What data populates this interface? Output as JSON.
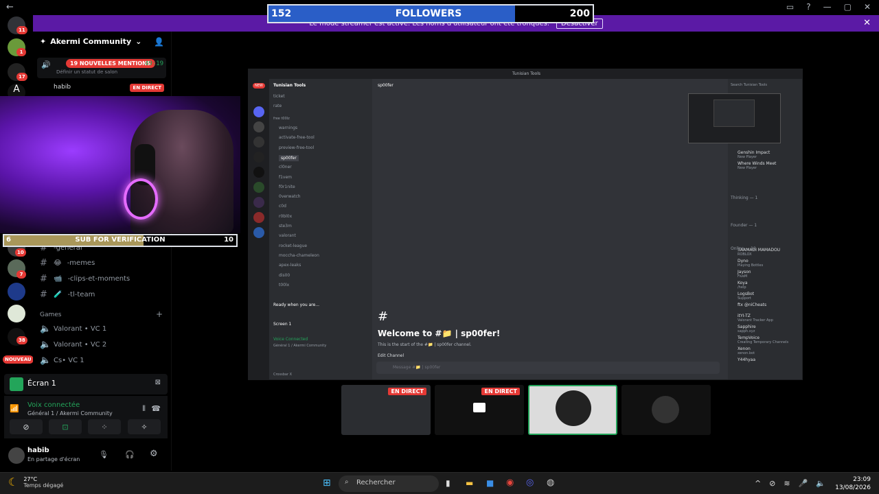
{
  "window": {
    "back": "←"
  },
  "followers": {
    "current": "152",
    "label": "FOLLOWERS",
    "goal": "200",
    "progress": 0.76
  },
  "banner": {
    "text": "Le mode streamer est activé. Les noms d'utilisateur ont été tronqués.",
    "button": "Désactiver"
  },
  "server": {
    "name": "Akermi Community"
  },
  "voice": {
    "mentions": "19 NOUVELLES MENTIONS",
    "timer": "49:19",
    "status_placeholder": "Définir un statut de salon",
    "user": "habib",
    "live": "EN DIRECT"
  },
  "rail_badges": [
    "11",
    "1",
    "17",
    "10",
    "7",
    "38",
    "1"
  ],
  "rail_new": "NOUVEAU",
  "channels": [
    {
      "label": "-general",
      "icon": ""
    },
    {
      "label": "-memes",
      "icon": "😂"
    },
    {
      "label": "-clips-et-moments",
      "icon": "📹"
    },
    {
      "label": "-tl-team",
      "icon": "🧪"
    }
  ],
  "games_category": "Games",
  "voice_channels": [
    "Valorant • VC 1",
    "Valorant • VC 2",
    "Cs• VC 1"
  ],
  "sub": {
    "current": "6",
    "label": "SUB FOR VERIFICATION",
    "goal": "10",
    "progress": 0.6
  },
  "screen_panel": {
    "label": "Écran 1"
  },
  "voice_panel": {
    "status": "Voix connectée",
    "location": "Général 1 / Akermi Community"
  },
  "user_panel": {
    "name": "habib",
    "status": "En partage d'écran"
  },
  "share": {
    "title": "Tunisian Tools",
    "server_name": "Tunisian Tools",
    "channel_header": "sp00fer",
    "top_channels": [
      "ticket",
      "rate"
    ],
    "category": "free t00lz",
    "channels": [
      "warnings",
      "activate-free-tool",
      "preview-free-tool",
      "sp00fer",
      "cl0ner",
      "f1vem",
      "f0r1nite",
      "0verwatch",
      "c0d",
      "r0bl0x",
      "ste3m",
      "valorant",
      "rocket-league",
      "moccha-chameleon",
      "apex-leaks",
      "dis00",
      "t00lx"
    ],
    "voice_status": "Voice Connected",
    "voice_location": "Général 1 / Akermi Community",
    "screen_label": "Screen 1",
    "ready_text": "Ready when you are...",
    "welcome": "Welcome to #📁 | sp00fer!",
    "welcome_sub": "This is the start of the #📁 | sp00fer channel.",
    "edit": "Edit Channel",
    "message_placeholder": "Message #📁 | sp00fer",
    "search": "Search Tunisian Tools",
    "member_groups": [
      "Thinking — 1",
      "Founder — 1",
      "Online — 12"
    ],
    "members": [
      {
        "name": "Genshin Impact",
        "sub": "New Player"
      },
      {
        "name": "Where Winds Meet",
        "sub": "New Player"
      },
      {
        "name": "3AAMADI MAMADOU",
        "sub": "ROBLOX"
      },
      {
        "name": "Dyno",
        "sub": "Playing Bottles"
      },
      {
        "name": "Jayson",
        "sub": "FiveM"
      },
      {
        "name": "Koya",
        "sub": "/help"
      },
      {
        "name": "LogsBot",
        "sub": "Support"
      },
      {
        "name": "ftx @niCheats",
        "sub": ""
      },
      {
        "name": "itYI-TZ",
        "sub": "Valorant Tracker App"
      },
      {
        "name": "Sapphire",
        "sub": "sapph.xyz"
      },
      {
        "name": "TempVoice",
        "sub": "Creating Temporary Channels"
      },
      {
        "name": "Xenon",
        "sub": "xenon.bot"
      },
      {
        "name": "Y44hyaa",
        "sub": ""
      }
    ],
    "user": "Crossbar X"
  },
  "tiles": [
    {
      "live": "EN DIRECT"
    },
    {
      "live": "EN DIRECT"
    }
  ],
  "taskbar": {
    "temp": "27°C",
    "weather": "Temps dégagé",
    "search": "Rechercher",
    "time": "23:09",
    "date": "13/08/2026"
  },
  "colors": {
    "live": "#e53935",
    "accent": "#5865f2",
    "voice_green": "#23a55a",
    "followers_fill": "#2a5ec7",
    "sub_fill": "#a9975a"
  }
}
